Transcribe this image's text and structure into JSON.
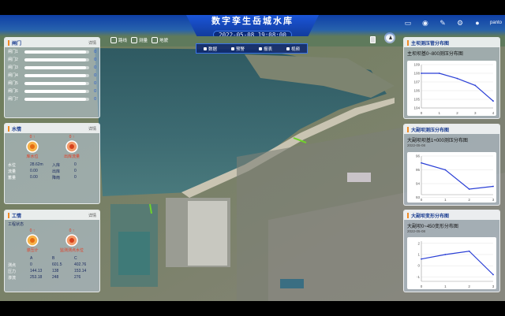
{
  "header": {
    "title": "数字孪生岳城水库",
    "datetime": "2022-05-08 19:08:00",
    "user": "panto",
    "icons": [
      "monitor-icon",
      "message-icon",
      "wrench-icon",
      "settings-icon",
      "user-icon"
    ]
  },
  "toolbar": {
    "items": [
      {
        "label": "路线",
        "icon": "route-icon"
      },
      {
        "label": "测量",
        "icon": "measure-icon"
      },
      {
        "label": "地貌",
        "icon": "terrain-icon"
      }
    ]
  },
  "layer_bar": {
    "items": [
      {
        "label": "数据",
        "icon": "data-icon"
      },
      {
        "label": "预警",
        "icon": "warning-icon"
      },
      {
        "label": "报表",
        "icon": "report-icon"
      },
      {
        "label": "视频",
        "icon": "video-icon"
      }
    ]
  },
  "gate_panel": {
    "title": "闸门",
    "more": "详情",
    "rows": [
      {
        "label": "闸门1",
        "value": "0",
        "fill": 0.95
      },
      {
        "label": "闸门2",
        "value": "0",
        "fill": 0.95
      },
      {
        "label": "闸门3",
        "value": "0",
        "fill": 0.95
      },
      {
        "label": "闸门4",
        "value": "0",
        "fill": 0.95
      },
      {
        "label": "闸门5",
        "value": "0",
        "fill": 0.95
      },
      {
        "label": "闸门6",
        "value": "0",
        "fill": 0.95
      },
      {
        "label": "闸门7",
        "value": "0",
        "fill": 0.95
      }
    ]
  },
  "water_panel": {
    "title": "水情",
    "more": "详情",
    "gauges": [
      {
        "value": "0 ↑",
        "label": "库水位"
      },
      {
        "value": "0 ↑",
        "label": "出库流量"
      }
    ],
    "table": [
      [
        "水位",
        "28.62m",
        "入库",
        "0"
      ],
      [
        "流量",
        "0.00",
        "出库",
        "0"
      ],
      [
        "蓄量",
        "0.00",
        "降雨",
        "0"
      ]
    ]
  },
  "work_panel": {
    "title": "工情",
    "more": "详情",
    "subtitle": "工程状态",
    "gauges": [
      {
        "value": "0 ↑",
        "label": "渗压计"
      },
      {
        "value": "0 ↑",
        "label": "监测测点水位"
      }
    ],
    "table": [
      [
        "",
        "A",
        "B",
        "C"
      ],
      [
        "测点",
        "0",
        "601.5",
        "402.76"
      ],
      [
        "压力",
        "144.13",
        "138",
        "153.14"
      ],
      [
        "渗流",
        "253.18",
        "248",
        "276"
      ]
    ]
  },
  "chart_panels": [
    {
      "title": "主坝测压管分布图",
      "chart_title": "主坝坝基0~800测压分布图",
      "date": ""
    },
    {
      "title": "大副坝测压分布图",
      "chart_title": "大副坝坝基1+000测压分布图",
      "date": "2022-05-08"
    },
    {
      "title": "大副坝变形分布图",
      "chart_title": "大副坝0~450变形分布图",
      "date": "2022-05-08"
    }
  ],
  "chart_data": [
    {
      "type": "line",
      "title": "主坝坝基0~800测压分布图",
      "x": [
        "0",
        "1",
        "2",
        "3",
        "4"
      ],
      "series": [
        {
          "values": [
            108,
            108,
            107.4,
            106.6,
            104.8
          ]
        }
      ],
      "yticks": [
        "109",
        "108",
        "107",
        "106",
        "105",
        "104"
      ],
      "ylim": [
        104,
        109
      ]
    },
    {
      "type": "line",
      "title": "大副坝坝基1+000测压分布图",
      "x": [
        "0",
        "1",
        "2",
        "3"
      ],
      "series": [
        {
          "values": [
            95.5,
            95.0,
            93.6,
            93.8
          ]
        }
      ],
      "yticks": [
        "96",
        "95",
        "94",
        "93"
      ],
      "ylim": [
        93.2,
        96
      ]
    },
    {
      "type": "line",
      "title": "大副坝0~450变形分布图",
      "x": [
        "0",
        "1",
        "2",
        "3"
      ],
      "series": [
        {
          "values": [
            0.6,
            1.0,
            1.3,
            -0.8
          ]
        }
      ],
      "yticks": [
        "2",
        "1",
        "0",
        "-1"
      ],
      "ylim": [
        -1.4,
        2.2
      ]
    }
  ],
  "colors": {
    "header_blue": "#1a55d8",
    "accent_orange": "#f08a24",
    "alert_red": "#e53a20",
    "line_blue": "#2a3fd6"
  }
}
